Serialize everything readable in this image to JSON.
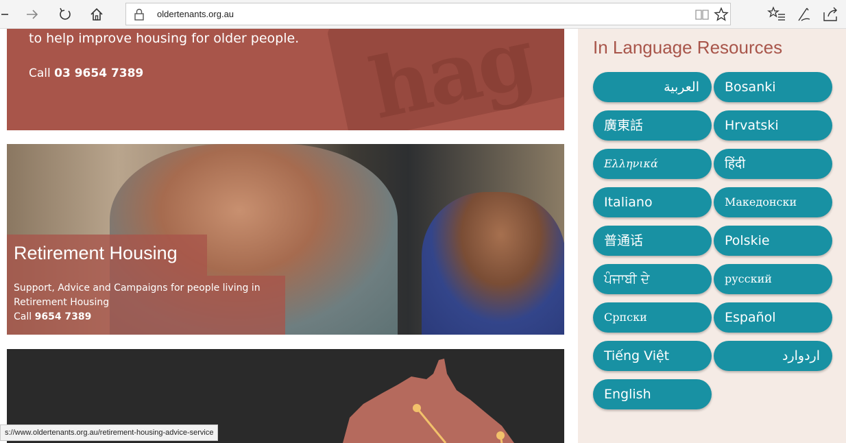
{
  "browser": {
    "url": "oldertenants.org.au",
    "status_url": "s://www.oldertenants.org.au/retirement-housing-advice-service"
  },
  "hero_top": {
    "text_line": "to help improve housing for older people.",
    "call_prefix": "Call",
    "call_number": "03 9654 7389",
    "watermark": "hag"
  },
  "retirement": {
    "title": "Retirement Housing",
    "description": "Support, Advice and Campaigns for people living in Retirement Housing",
    "call_prefix": "Call",
    "call_number": "9654 7389"
  },
  "sidebar": {
    "title": "In Language Resources",
    "languages": [
      "العربية",
      "Bosanki",
      "廣東話",
      "Hrvatski",
      "Ελληνικά",
      "हिंदी",
      "Italiano",
      "Македонски",
      "普通话",
      "Polskie",
      "ਪੰਜਾਬੀ ਦੇ",
      "русский",
      "Српски",
      "Español",
      "Tiếng Việt",
      "اردوارد",
      "English"
    ]
  },
  "colors": {
    "brand": "#a8554a",
    "button": "#1891a3",
    "sidebar_bg": "#f5ebe5"
  }
}
